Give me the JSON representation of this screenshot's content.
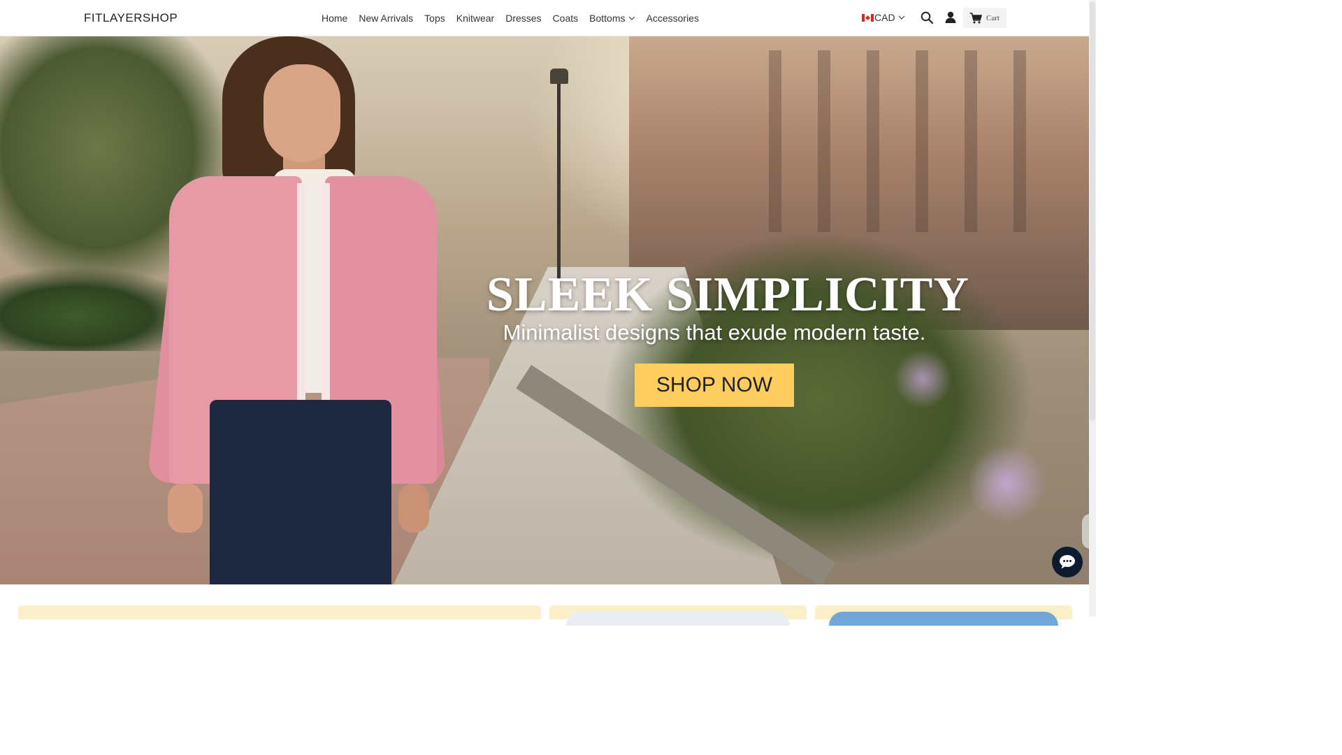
{
  "brand": {
    "name": "FITLAYERSHOP"
  },
  "nav": {
    "items": [
      {
        "label": "Home"
      },
      {
        "label": "New Arrivals"
      },
      {
        "label": "Tops"
      },
      {
        "label": "Knitwear"
      },
      {
        "label": "Dresses"
      },
      {
        "label": "Coats"
      },
      {
        "label": "Bottoms",
        "has_dropdown": true
      },
      {
        "label": "Accessories"
      }
    ]
  },
  "header": {
    "currency": "CAD",
    "currency_flag": "canada-flag",
    "icons": [
      "search-icon",
      "account-icon",
      "cart-icon"
    ],
    "cart_label": "Cart"
  },
  "hero": {
    "title": "SLEEK SIMPLICITY",
    "subtitle": "Minimalist designs that exude modern taste.",
    "cta_label": "SHOP NOW",
    "cta_color": "#fecd5f"
  },
  "chat": {
    "icon": "chat-icon",
    "color": "#0e1b2e"
  },
  "colors": {
    "accent": "#fecd5f",
    "card_bg": "#fbefc8"
  }
}
